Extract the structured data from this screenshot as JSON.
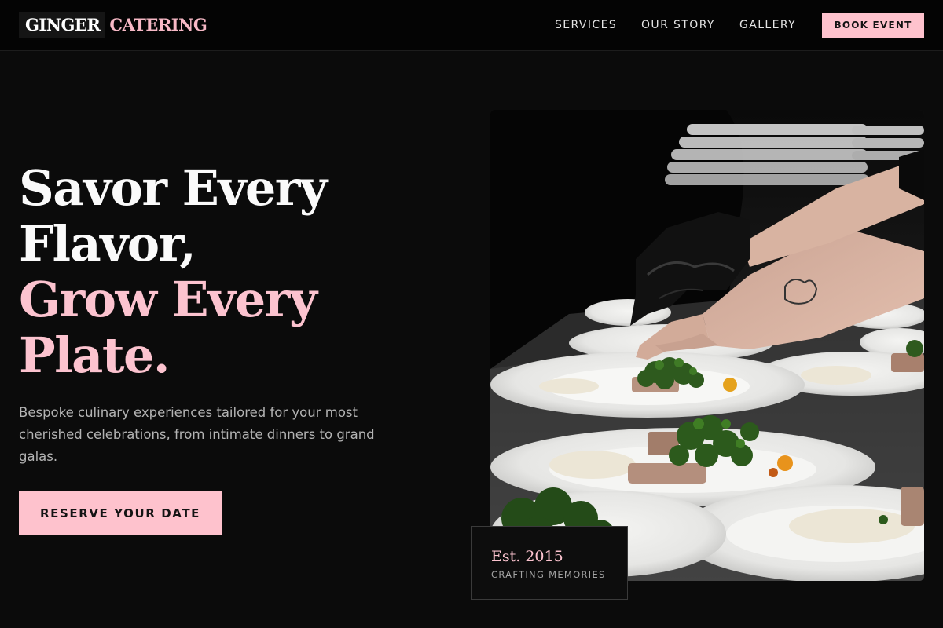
{
  "brand": {
    "name_part1": "GINGER",
    "name_part2": "CATERING"
  },
  "nav": {
    "links": [
      {
        "label": "SERVICES"
      },
      {
        "label": "OUR STORY"
      },
      {
        "label": "GALLERY"
      }
    ],
    "cta_label": "BOOK EVENT"
  },
  "hero": {
    "headline_line1": "Savor Every",
    "headline_line2": "Flavor,",
    "headline_line3": "Grow Every",
    "headline_line4": "Plate.",
    "subtitle": "Bespoke culinary experiences tailored for your most cherished celebrations, from intimate dinners to grand galas.",
    "cta_label": "RESERVE YOUR DATE"
  },
  "badge": {
    "year": "Est. 2015",
    "caption": "CRAFTING MEMORIES"
  },
  "colors": {
    "accent": "#fec2cd",
    "background": "#0b0b0b",
    "nav_background": "#040404"
  }
}
